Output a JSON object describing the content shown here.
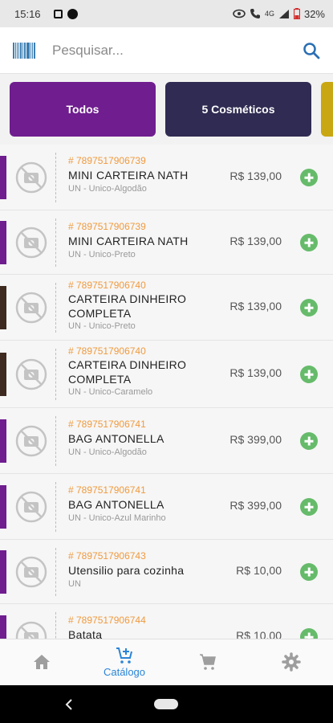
{
  "status_bar": {
    "time": "15:16",
    "network": "4G",
    "battery": "32%"
  },
  "search": {
    "placeholder": "Pesquisar..."
  },
  "categories": [
    {
      "label": "Todos",
      "color": "#6f1d8f"
    },
    {
      "label": "5 Cosméticos",
      "color": "#2f2b52"
    },
    {
      "label": "",
      "color": "#c9a713"
    }
  ],
  "products": [
    {
      "code": "# 7897517906739",
      "name": "MINI CARTEIRA NATH",
      "variant": "UN - Unico-Algodão",
      "price": "R$ 139,00",
      "color": "#6f1d8f"
    },
    {
      "code": "# 7897517906739",
      "name": "MINI CARTEIRA NATH",
      "variant": "UN - Unico-Preto",
      "price": "R$ 139,00",
      "color": "#6f1d8f"
    },
    {
      "code": "# 7897517906740",
      "name": "CARTEIRA DINHEIRO COMPLETA",
      "variant": "UN - Unico-Preto",
      "price": "R$ 139,00",
      "color": "#3e2a1f"
    },
    {
      "code": "# 7897517906740",
      "name": "CARTEIRA DINHEIRO COMPLETA",
      "variant": "UN - Unico-Caramelo",
      "price": "R$ 139,00",
      "color": "#3e2a1f"
    },
    {
      "code": "# 7897517906741",
      "name": "BAG ANTONELLA",
      "variant": "UN - Unico-Algodão",
      "price": "R$ 399,00",
      "color": "#6f1d8f"
    },
    {
      "code": "# 7897517906741",
      "name": "BAG ANTONELLA",
      "variant": "UN - Unico-Azul Marinho",
      "price": "R$ 399,00",
      "color": "#6f1d8f"
    },
    {
      "code": "# 7897517906743",
      "name": "Utensilio para cozinha",
      "variant": "UN",
      "price": "R$ 10,00",
      "color": "#6f1d8f"
    },
    {
      "code": "# 7897517906744",
      "name": "Batata",
      "variant": "",
      "price": "R$ 10,00",
      "color": "#6f1d8f"
    }
  ],
  "bottom_nav": [
    {
      "icon": "home-icon",
      "label": ""
    },
    {
      "icon": "cart-add-icon",
      "label": "Catálogo",
      "active": true
    },
    {
      "icon": "cart-icon",
      "label": ""
    },
    {
      "icon": "gear-icon",
      "label": ""
    }
  ],
  "colors": {
    "accent": "#2a84d6",
    "add_button": "#66bb6a",
    "code_text": "#f09a3e"
  }
}
